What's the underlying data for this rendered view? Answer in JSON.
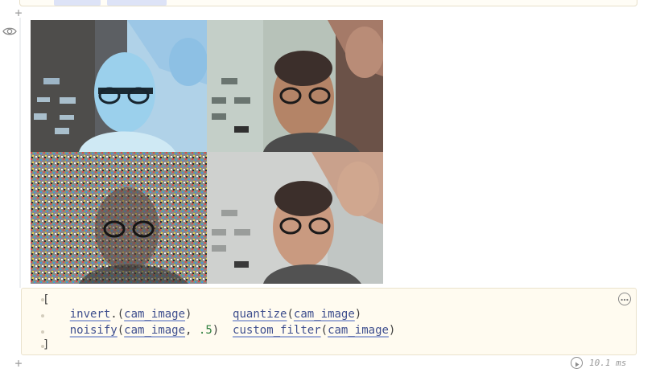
{
  "previous_cell": {},
  "controls": {
    "add_above": "+",
    "add_below": "+"
  },
  "output": {
    "tiles": [
      {
        "filter": "invert"
      },
      {
        "filter": "quantize"
      },
      {
        "filter": "noisify"
      },
      {
        "filter": "custom_filter"
      }
    ]
  },
  "code": {
    "open_bracket": "[",
    "row1": {
      "fn1": "invert",
      "dot": ".",
      "p1o": "(",
      "arg1": "cam_image",
      "p1c": ")",
      "fn2": "quantize",
      "p2o": "(",
      "arg2": "cam_image",
      "p2c": ")"
    },
    "row2": {
      "fn1": "noisify",
      "p1o": "(",
      "arg1": "cam_image",
      "sep": ", ",
      "num": ".5",
      "p1c": ")",
      "fn2": "custom_filter",
      "p2o": "(",
      "arg2": "cam_image",
      "p2c": ")"
    },
    "close_bracket": "]"
  },
  "status": {
    "run_time": "10.1 ms"
  },
  "colors": {
    "cell_bg": "#fffbf0",
    "link_blue": "#3f4f8e",
    "number_green": "#2d7f3d"
  }
}
